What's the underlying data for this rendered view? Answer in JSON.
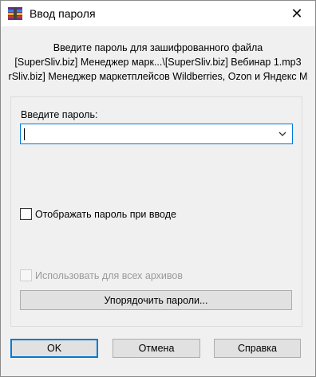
{
  "window": {
    "title": "Ввод пароля"
  },
  "info": {
    "line1": "Введите пароль для зашифрованного файла",
    "line2": "[SuperSliv.biz] Менеджер марк...\\[SuperSliv.biz] Вебинар 1.mp3",
    "line3": "rSliv.biz] Менеджер маркетплейсов Wildberries, Ozon и Яндекс М"
  },
  "password": {
    "label": "Введите пароль:",
    "value": ""
  },
  "show_password": {
    "label": "Отображать пароль при вводе",
    "checked": false
  },
  "use_for_all": {
    "label": "Использовать для всех архивов",
    "checked": false,
    "disabled": true
  },
  "organize_button": "Упорядочить пароли...",
  "buttons": {
    "ok": "OK",
    "cancel": "Отмена",
    "help": "Справка"
  },
  "icons": {
    "app": "winrar-icon",
    "close": "close-icon",
    "dropdown": "chevron-down-icon"
  },
  "colors": {
    "accent": "#0078d7",
    "disabled_text": "#9a9a9a"
  }
}
